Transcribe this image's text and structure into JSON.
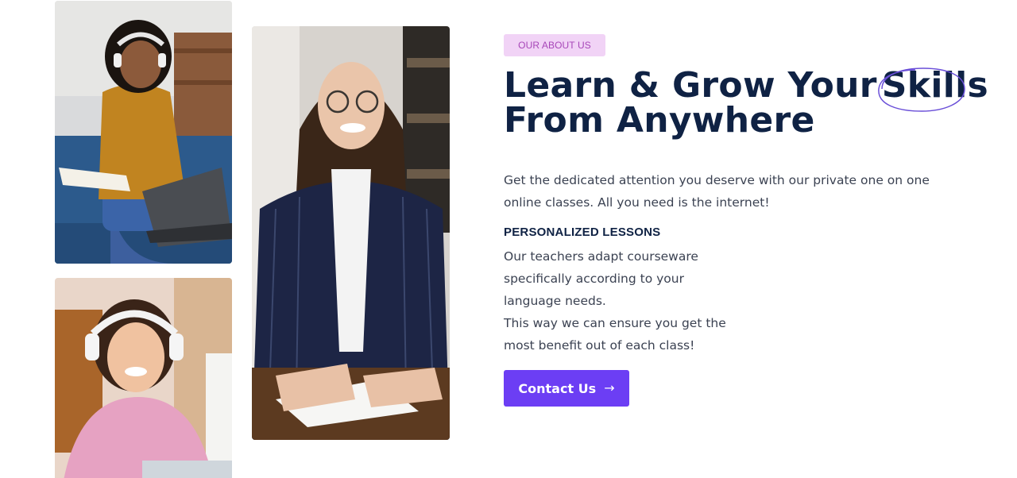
{
  "about": {
    "badge": "OUR ABOUT US",
    "heading_line1_prefix": "Learn & Grow Your",
    "heading_highlight": "Skills",
    "heading_line2": "From Anywhere",
    "description": "Get the dedicated attention you deserve with our private one on one online classes. All you need is the internet!",
    "sub_heading": "PERSONALIZED LESSONS",
    "sub_text_lines": [
      "Our teachers adapt courseware",
      "specifically according to your",
      "language needs.",
      "This way we can ensure you get the",
      "most benefit out of each class!"
    ],
    "cta_label": "Contact Us",
    "cta_icon": "arrow-right-icon"
  },
  "colors": {
    "heading": "#0f2244",
    "body_text": "#3b4252",
    "badge_bg": "#f1d3f6",
    "badge_text": "#a746b8",
    "accent": "#6c3ef4",
    "highlight_ring": "#6a4fd8"
  },
  "images": [
    "student-with-headphones-on-couch-photo",
    "student-with-headphones-pink-shirt-photo",
    "teacher-with-glasses-at-desk-photo"
  ]
}
